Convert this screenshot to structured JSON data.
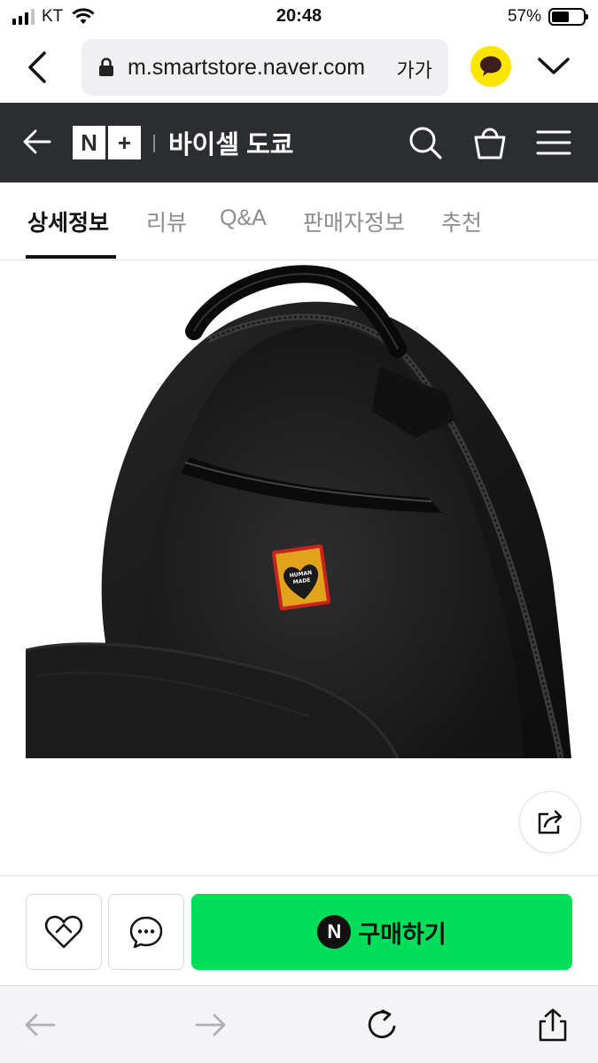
{
  "status": {
    "carrier": "KT",
    "time": "20:48",
    "battery": "57%"
  },
  "browser": {
    "url": "m.smartstore.naver.com",
    "text_size_label": "가가"
  },
  "store": {
    "name": "바이셀 도쿄",
    "logo_n": "N",
    "logo_plus": "+"
  },
  "tabs": [
    {
      "label": "상세정보",
      "active": true
    },
    {
      "label": "리뷰",
      "active": false
    },
    {
      "label": "Q&A",
      "active": false
    },
    {
      "label": "판매자정보",
      "active": false
    },
    {
      "label": "추천",
      "active": false
    }
  ],
  "product": {
    "image": "black-backpack-open-interior",
    "patch_text": [
      "HUMAN",
      "MADE"
    ]
  },
  "actions": {
    "buy_badge": "N",
    "buy_label": "구매하기",
    "buy_color": "#00de5a"
  },
  "colors": {
    "header_bg": "#2b2d30",
    "kakao_yellow": "#fee500"
  }
}
